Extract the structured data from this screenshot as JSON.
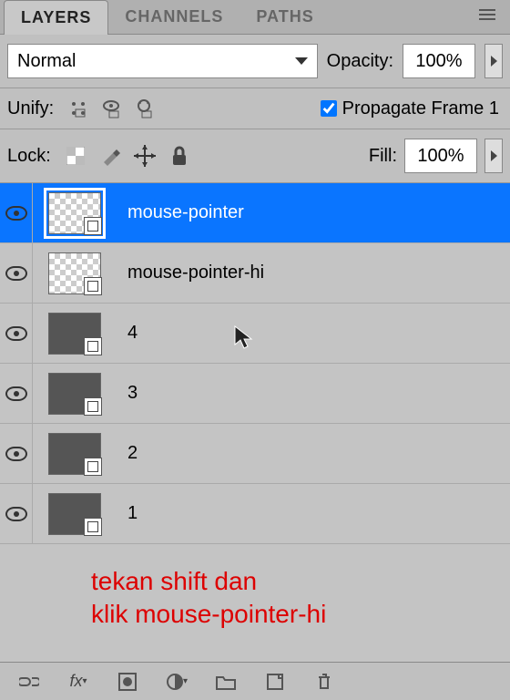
{
  "tabs": {
    "layers": "LAYERS",
    "channels": "CHANNELS",
    "paths": "PATHS"
  },
  "blend_mode": "Normal",
  "opacity": {
    "label": "Opacity:",
    "value": "100%"
  },
  "unify": {
    "label": "Unify:",
    "propagate_label": "Propagate Frame 1"
  },
  "lock": {
    "label": "Lock:"
  },
  "fill": {
    "label": "Fill:",
    "value": "100%"
  },
  "layers": [
    {
      "name": "mouse-pointer",
      "selected": true,
      "thumb": "checker"
    },
    {
      "name": "mouse-pointer-hi",
      "selected": false,
      "thumb": "checker"
    },
    {
      "name": "4",
      "selected": false,
      "thumb": "dark"
    },
    {
      "name": "3",
      "selected": false,
      "thumb": "dark"
    },
    {
      "name": "2",
      "selected": false,
      "thumb": "dark"
    },
    {
      "name": "1",
      "selected": false,
      "thumb": "dark"
    }
  ],
  "annotation": {
    "line1": "tekan shift dan",
    "line2": "klik mouse-pointer-hi"
  }
}
